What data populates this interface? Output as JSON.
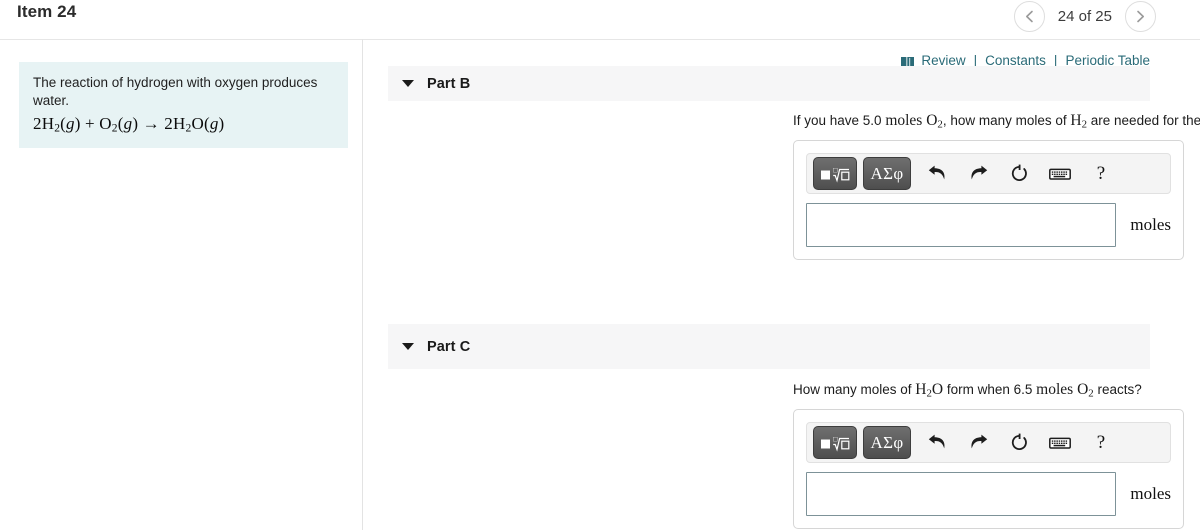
{
  "header": {
    "item_title": "Item 24",
    "pager": {
      "prev_icon": "chevron-left-icon",
      "next_icon": "chevron-right-icon",
      "label": "24 of 25"
    }
  },
  "problem": {
    "statement": "The reaction of hydrogen with oxygen produces water.",
    "equation_plain": "2H2(g) + O2(g) → 2H2O(g)",
    "equation_tokens": [
      {
        "t": "2H",
        "sub": "2"
      },
      {
        "t": "(",
        "italic_g": true
      },
      {
        "t": "+"
      },
      {
        "t": "O",
        "sub": "2"
      },
      {
        "t": "→"
      },
      {
        "t": "2H",
        "sub": "2"
      },
      {
        "t": "O"
      }
    ]
  },
  "reference": {
    "book_icon": "book-icon",
    "review_label": "Review",
    "separator": "|",
    "constants_label": "Constants",
    "periodic_table_label": "Periodic Table",
    "link_color": "#2a6b78"
  },
  "toolbar": {
    "template_button_icon": "math-template-icon",
    "greek_button_label": "ΑΣφ",
    "undo_icon": "undo-arrow-icon",
    "redo_icon": "redo-arrow-icon",
    "reset_icon": "reset-circle-icon",
    "keyboard_icon": "keyboard-icon",
    "help_label": "?"
  },
  "parts": [
    {
      "id": "part-b",
      "caret_icon": "caret-down-icon",
      "title": "Part B",
      "question_prefix": "If you have 5.0 ",
      "question_moles": "moles",
      "question_formula_1": "O",
      "question_formula_1_sub": "2",
      "question_mid": ", how many moles of ",
      "question_formula_2": "H",
      "question_formula_2_sub": "2",
      "question_suffix": " are needed for the reaction?",
      "answer_value": "",
      "answer_placeholder": "",
      "unit": "moles"
    },
    {
      "id": "part-c",
      "caret_icon": "caret-down-icon",
      "title": "Part C",
      "question_prefix": "How many moles of ",
      "question_formula_1": "H",
      "question_formula_1_sub": "2",
      "question_formula_1_tail": "O",
      "question_mid": " form when 6.5 ",
      "question_moles": "moles",
      "question_formula_2": "O",
      "question_formula_2_sub": "2",
      "question_suffix": " reacts?",
      "answer_value": "",
      "answer_placeholder": "",
      "unit": "moles"
    }
  ],
  "colors": {
    "problem_box_bg": "#e7f3f4",
    "part_header_bg": "#f6f6f7",
    "toolbar_bg": "#f4f4f4",
    "input_border": "#7d9298",
    "accent_teal": "#2a6b78"
  }
}
